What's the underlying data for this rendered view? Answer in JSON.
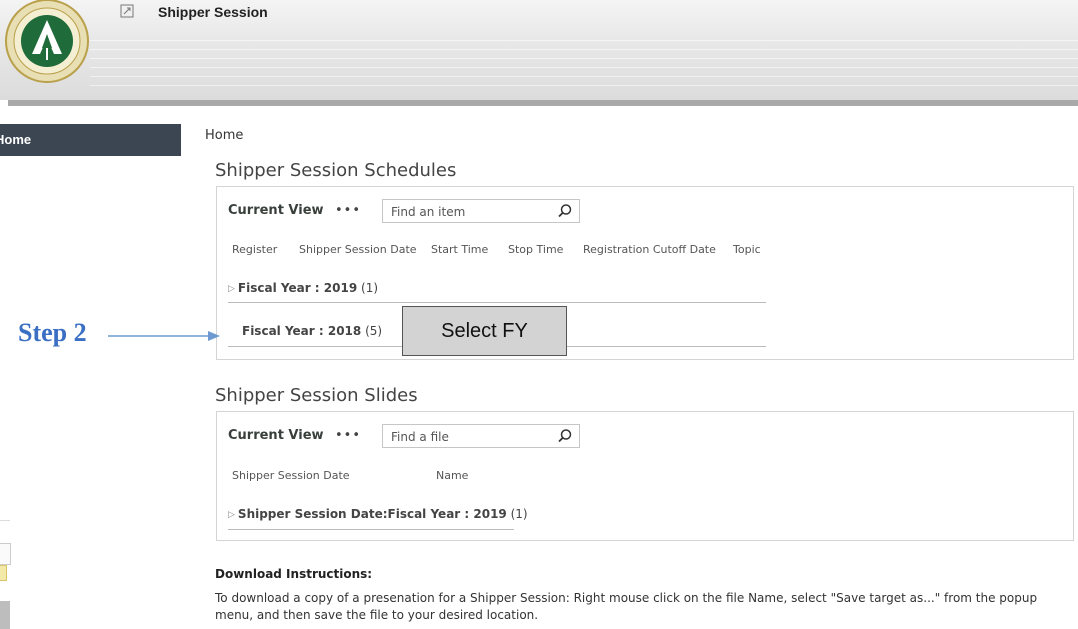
{
  "header": {
    "site_title": "Shipper Session",
    "logo_icon": "sddc-logo-icon",
    "title_icon": "edit-icon"
  },
  "nav": {
    "home_label": "Home"
  },
  "breadcrumb": "Home",
  "schedules": {
    "title": "Shipper Session Schedules",
    "current_view_label": "Current View",
    "more_label": "•••",
    "search_placeholder": "Find an item",
    "columns": [
      "Register",
      "Shipper Session Date",
      "Start Time",
      "Stop Time",
      "Registration Cutoff Date",
      "Topic"
    ],
    "groups": [
      {
        "label": "Fiscal Year : ",
        "value": "2019",
        "count": "(1)"
      },
      {
        "label": "Fiscal Year : ",
        "value": "2018",
        "count": "(5)"
      }
    ]
  },
  "slides": {
    "title": "Shipper Session Slides",
    "current_view_label": "Current View",
    "more_label": "•••",
    "search_placeholder": "Find a file",
    "columns": [
      "Shipper Session Date",
      "Name"
    ],
    "groups": [
      {
        "label": "Shipper Session Date:Fiscal Year : ",
        "value": "2019",
        "count": "(1)"
      }
    ]
  },
  "annotation": {
    "step_label": "Step 2",
    "callout_text": "Select FY",
    "arrow_color": "#6d9bd1"
  },
  "instructions": {
    "title": "Download Instructions:",
    "text": "To download a copy of a presenation for a Shipper Session: Right mouse click on the file Name, select \"Save target as...\" from the popup menu, and then save the file to your desired location."
  },
  "colors": {
    "nav_bg": "#3c4652",
    "step_blue": "#3a6fc4"
  }
}
